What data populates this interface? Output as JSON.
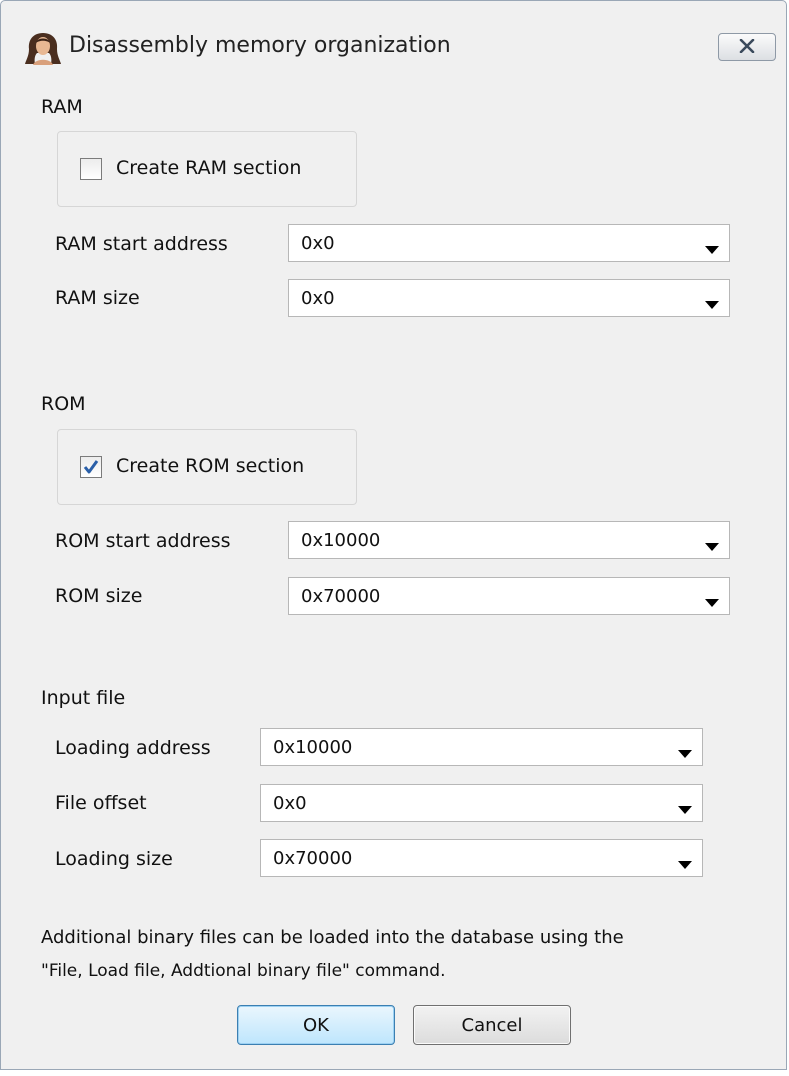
{
  "window": {
    "title": "Disassembly memory organization"
  },
  "icons": {
    "app": "woman-portrait-icon",
    "close": "close-icon",
    "dropdown": "triangle-down-icon",
    "check": "check-mark-icon"
  },
  "ram": {
    "section_label": "RAM",
    "create_label": "Create RAM section",
    "create_checked": false,
    "start_label": "RAM start address",
    "start_value": "0x0",
    "size_label": "RAM size",
    "size_value": "0x0"
  },
  "rom": {
    "section_label": "ROM",
    "create_label": "Create ROM section",
    "create_checked": true,
    "start_label": "ROM start address",
    "start_value": "0x10000",
    "size_label": "ROM size",
    "size_value": "0x70000"
  },
  "input_file": {
    "section_label": "Input file",
    "loading_address_label": "Loading address",
    "loading_address_value": "0x10000",
    "file_offset_label": "File offset",
    "file_offset_value": "0x0",
    "loading_size_label": "Loading size",
    "loading_size_value": "0x70000"
  },
  "note": {
    "line1": "Additional binary files can be loaded into the database using the",
    "line2": "\"File, Load file, Addtional binary file\" command."
  },
  "buttons": {
    "ok": "OK",
    "cancel": "Cancel"
  },
  "colors": {
    "dialog_bg": "#f0f0f0",
    "checkbox_tick": "#2a5fa8",
    "ok_button_border": "#3c7fb1"
  }
}
